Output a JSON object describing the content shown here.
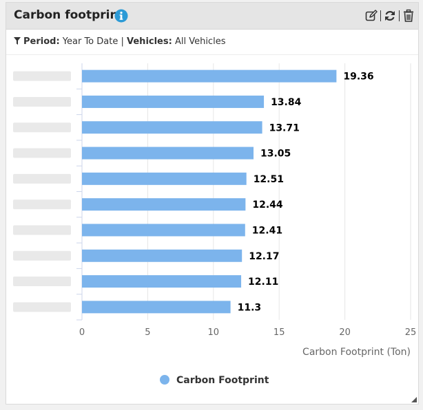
{
  "widget": {
    "title": "Carbon footprint",
    "filters": {
      "period_label": "Period:",
      "period_value": "Year To Date",
      "divider": "|",
      "vehicles_label": "Vehicles:",
      "vehicles_value": "All Vehicles"
    },
    "icons": {
      "info": "info-icon",
      "edit": "edit-icon",
      "refresh": "refresh-icon",
      "delete": "trash-icon",
      "filter": "filter-icon"
    }
  },
  "colors": {
    "bar": "#7cb4ec",
    "header_bg": "#e5e5e5",
    "info_icon": "#2b9ad6"
  },
  "chart_data": {
    "type": "bar",
    "orientation": "horizontal",
    "categories": [
      "",
      "",
      "",
      "",
      "",
      "",
      "",
      "",
      "",
      ""
    ],
    "category_labels_obscured": true,
    "series": [
      {
        "name": "Carbon Footprint",
        "values": [
          19.36,
          13.84,
          13.71,
          13.05,
          12.51,
          12.44,
          12.41,
          12.17,
          12.11,
          11.3
        ]
      }
    ],
    "data_labels": [
      "19.36",
      "13.84",
      "13.71",
      "13.05",
      "12.51",
      "12.44",
      "12.41",
      "12.17",
      "12.11",
      "11.3"
    ],
    "xlabel": "Carbon Footprint (Ton)",
    "xlim": [
      0,
      25
    ],
    "xticks": [
      0,
      5,
      10,
      15,
      20,
      25
    ],
    "grid": true,
    "legend": "bottom-center"
  }
}
